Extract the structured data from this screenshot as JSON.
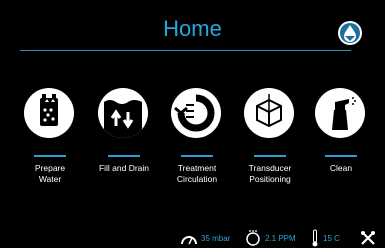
{
  "header": {
    "title": "Home",
    "home_icon": "water-drop-icon"
  },
  "tiles": [
    {
      "label": "Prepare\nWater",
      "icon": "water-tank-icon"
    },
    {
      "label": "Fill and Drain",
      "icon": "fill-drain-icon"
    },
    {
      "label": "Treatment\nCirculation",
      "icon": "circulation-icon"
    },
    {
      "label": "Transducer\nPositioning",
      "icon": "cube-axes-icon"
    },
    {
      "label": "Clean",
      "icon": "spray-bottle-icon"
    }
  ],
  "status": {
    "pressure": "35 mbar",
    "flow": "2.1 PPM",
    "temperature": "15 C",
    "tools_icon": "tools-icon"
  },
  "colors": {
    "accent": "#26a6dd",
    "background": "#000000"
  }
}
